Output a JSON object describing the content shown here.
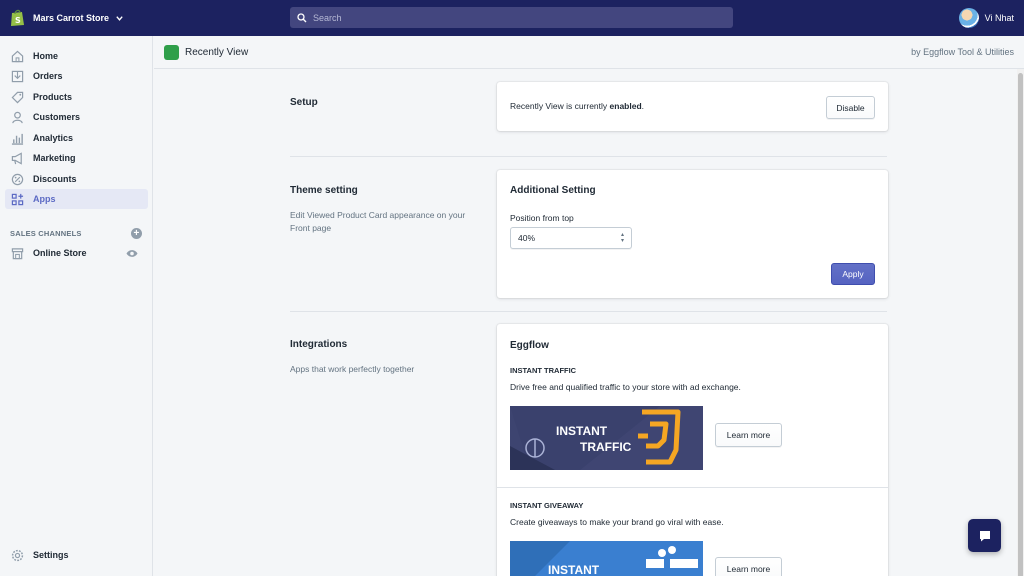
{
  "topbar": {
    "store_name": "Mars Carrot Store",
    "search_placeholder": "Search",
    "user_name": "Vi Nhat",
    "bg_color": "#1c2260"
  },
  "sidebar": {
    "items": [
      {
        "label": "Home",
        "icon": "home-icon"
      },
      {
        "label": "Orders",
        "icon": "orders-icon"
      },
      {
        "label": "Products",
        "icon": "tag-icon"
      },
      {
        "label": "Customers",
        "icon": "person-icon"
      },
      {
        "label": "Analytics",
        "icon": "bar-chart-icon"
      },
      {
        "label": "Marketing",
        "icon": "megaphone-icon"
      },
      {
        "label": "Discounts",
        "icon": "discount-icon"
      },
      {
        "label": "Apps",
        "icon": "apps-icon",
        "active": true
      }
    ],
    "sales_channels_title": "SALES CHANNELS",
    "online_store": "Online Store",
    "settings": "Settings"
  },
  "app_header": {
    "title": "Recently View",
    "by": "by Eggflow Tool & Utilities"
  },
  "setup": {
    "title": "Setup",
    "status_prefix": "Recently View is currently ",
    "status_value": "enabled",
    "status_suffix": ".",
    "disable_label": "Disable"
  },
  "theme": {
    "title": "Theme setting",
    "description": "Edit Viewed Product Card appearance on your Front page",
    "card_title": "Additional Setting",
    "position_label": "Position from top",
    "position_value": "40%",
    "apply_label": "Apply",
    "accent": "#5c6ac4"
  },
  "integrations": {
    "title": "Integrations",
    "description": "Apps that work perfectly together",
    "card_title": "Eggflow",
    "items": [
      {
        "heading": "INSTANT TRAFFIC",
        "text": "Drive free and qualified traffic to your store with ad exchange.",
        "banner_line1": "INSTANT",
        "banner_line2": "TRAFFIC",
        "button": "Learn more"
      },
      {
        "heading": "INSTANT GIVEAWAY",
        "text": "Create giveaways to make your brand go viral with ease.",
        "banner_line1": "INSTANT",
        "button": "Learn more"
      }
    ]
  }
}
